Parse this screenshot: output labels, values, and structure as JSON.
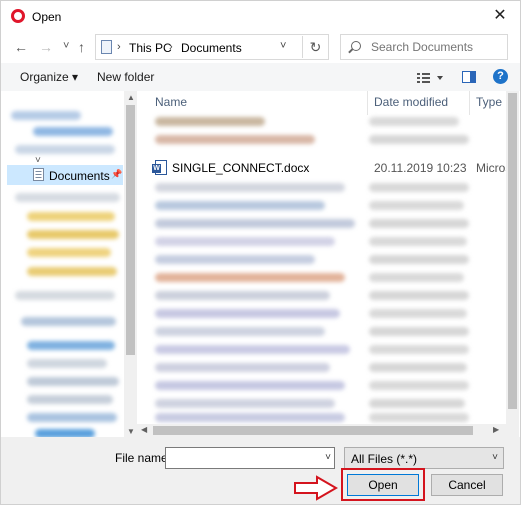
{
  "window": {
    "title": "Open",
    "close_glyph": "✕"
  },
  "nav": {
    "back_glyph": "←",
    "forward_glyph": "→",
    "recent_glyph": "˅",
    "up_glyph": "↑",
    "breadcrumb": [
      "This PC",
      "Documents"
    ],
    "separator_glyph": "›",
    "dropdown_glyph": "˅",
    "refresh_glyph": "↻"
  },
  "search": {
    "placeholder": "Search Documents"
  },
  "toolbar": {
    "organize_label": "Organize ▾",
    "new_folder_label": "New folder",
    "help_glyph": "?"
  },
  "sidebar": {
    "selected_item": "Documents"
  },
  "columns": {
    "name": "Name",
    "date_modified": "Date modified",
    "type": "Type"
  },
  "files": [
    {
      "name": "SINGLE_CONNECT.docx",
      "date": "20.11.2019 10:23",
      "type": "Micros"
    }
  ],
  "bottom": {
    "file_name_label": "File name:",
    "file_name_value": "",
    "filter_value": "All Files (*.*)",
    "open_label": "Open",
    "cancel_label": "Cancel"
  },
  "colors": {
    "highlight": "#d4141e",
    "accent": "#0078d7",
    "opera": "#e0162b"
  }
}
